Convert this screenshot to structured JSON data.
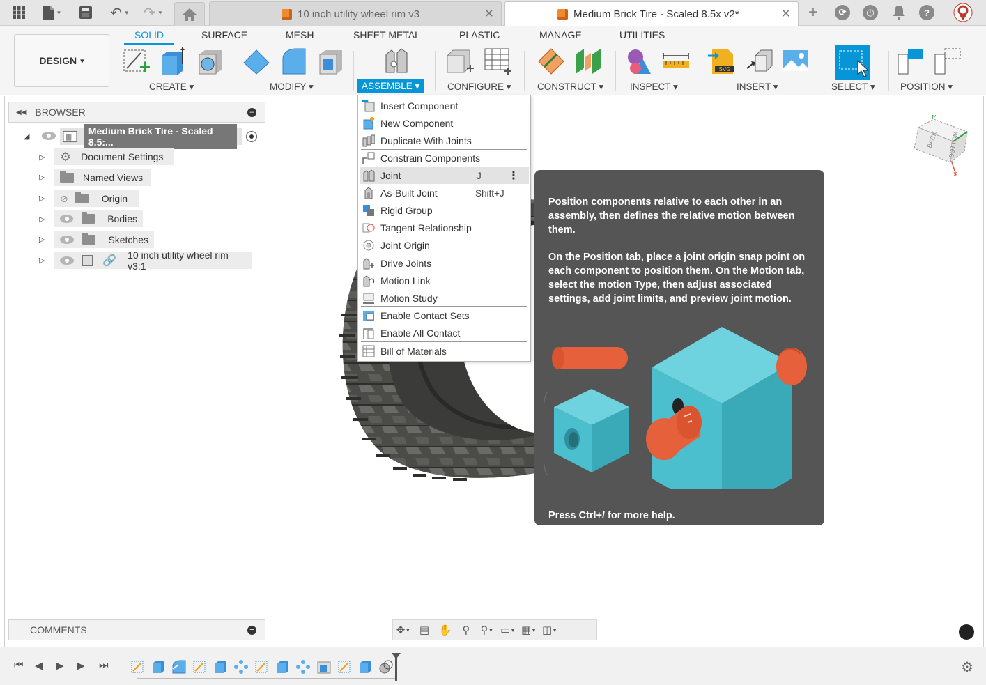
{
  "titlebar": {
    "tabs": [
      {
        "label": "10 inch utility wheel rim v3",
        "active": false
      },
      {
        "label": "Medium Brick Tire - Scaled 8.5x v2*",
        "active": true
      }
    ],
    "close_glyph": "✕",
    "icons": [
      "apps-grid-icon",
      "file-icon",
      "save-icon",
      "undo-icon",
      "redo-icon",
      "home-icon",
      "add-tab-icon",
      "extensions-icon",
      "job-status-icon",
      "notifications-icon",
      "help-icon",
      "profile-icon"
    ]
  },
  "ribbon": {
    "workspace": "DESIGN",
    "tabs": [
      "SOLID",
      "SURFACE",
      "MESH",
      "SHEET METAL",
      "PLASTIC",
      "MANAGE",
      "UTILITIES"
    ],
    "active_tab": "SOLID",
    "groups": [
      "CREATE",
      "MODIFY",
      "ASSEMBLE",
      "CONFIGURE",
      "CONSTRUCT",
      "INSPECT",
      "INSERT",
      "SELECT",
      "POSITION"
    ],
    "active_group": "ASSEMBLE",
    "caret": "▾",
    "accent": "#0696d7"
  },
  "browser": {
    "title": "BROWSER",
    "root": "Medium Brick Tire - Scaled 8.5:...",
    "items": [
      {
        "label": "Document Settings"
      },
      {
        "label": "Named Views"
      },
      {
        "label": "Origin"
      },
      {
        "label": "Bodies"
      },
      {
        "label": "Sketches"
      },
      {
        "label": "10 inch utility wheel rim v3:1"
      }
    ]
  },
  "assemble_menu": {
    "items": [
      {
        "label": "Insert Component",
        "shortcut": ""
      },
      {
        "label": "New Component",
        "shortcut": ""
      },
      {
        "label": "Duplicate With Joints",
        "shortcut": ""
      },
      {
        "label": "Constrain Components",
        "shortcut": ""
      },
      {
        "label": "Joint",
        "shortcut": "J",
        "hovered": true
      },
      {
        "label": "As-Built Joint",
        "shortcut": "Shift+J"
      },
      {
        "label": "Rigid Group",
        "shortcut": ""
      },
      {
        "label": "Tangent Relationship",
        "shortcut": ""
      },
      {
        "label": "Joint Origin",
        "shortcut": ""
      },
      {
        "label": "Drive Joints",
        "shortcut": ""
      },
      {
        "label": "Motion Link",
        "shortcut": ""
      },
      {
        "label": "Motion Study",
        "shortcut": ""
      },
      {
        "label": "Enable Contact Sets",
        "shortcut": ""
      },
      {
        "label": "Enable All Contact",
        "shortcut": ""
      },
      {
        "label": "Bill of Materials",
        "shortcut": ""
      }
    ]
  },
  "tooltip": {
    "para1": "Position components relative to each other in an assembly, then defines the relative motion between them.",
    "para2": "On the Position tab, place a joint origin snap point on each component to position them. On the Motion tab, select the motion Type, then adjust associated settings, add joint limits, and preview joint motion.",
    "footer": "Press Ctrl+/ for more help.",
    "colors": {
      "bg": "#555555",
      "cyan": "#4bbfce",
      "orange": "#e5603b"
    }
  },
  "comments": {
    "title": "COMMENTS"
  },
  "viewcube": {
    "faces": [
      "BACK",
      "BOTTOM"
    ],
    "axes": [
      "Y",
      "X"
    ]
  }
}
